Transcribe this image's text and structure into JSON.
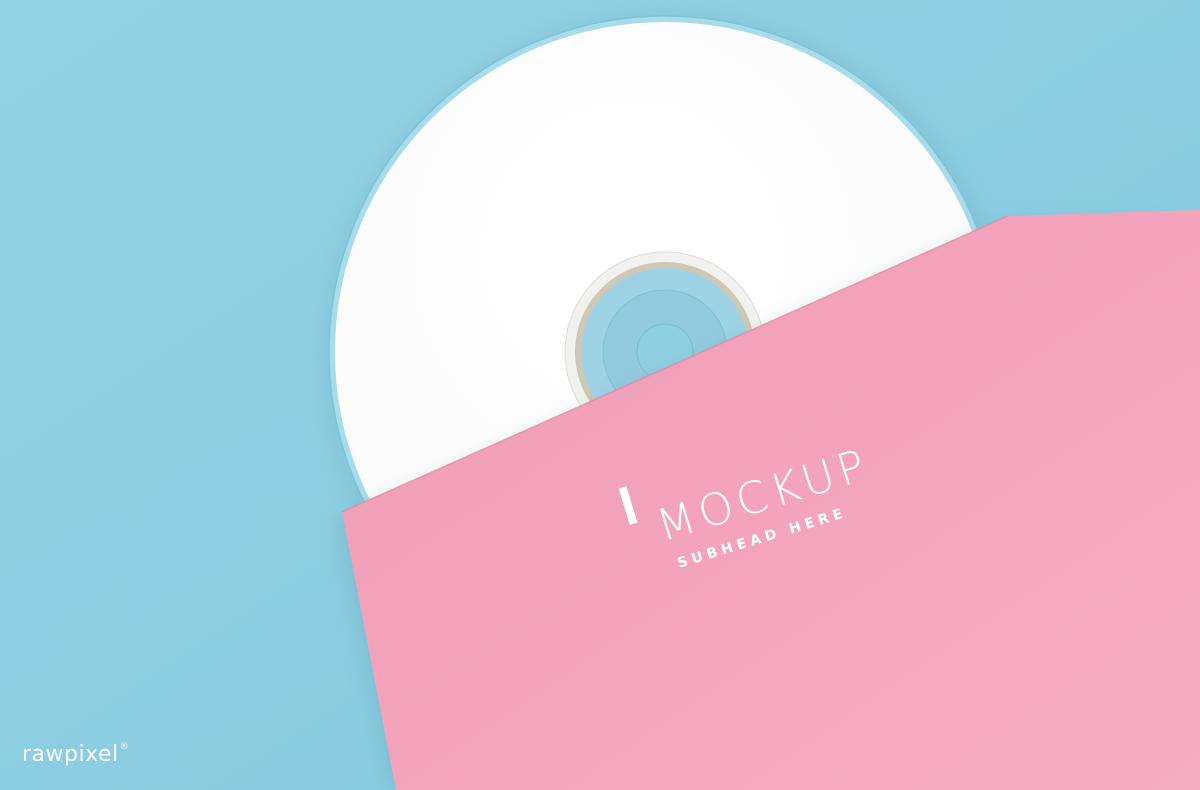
{
  "scene": {
    "background_color": "#8ecfe2",
    "disc_color": "#ffffff",
    "sleeve_color": "#f3a6bd"
  },
  "sleeve": {
    "title": "MOCKUP",
    "subtitle": "SUBHEAD HERE"
  },
  "watermark": {
    "text": "rawpixel",
    "mark": "®"
  }
}
